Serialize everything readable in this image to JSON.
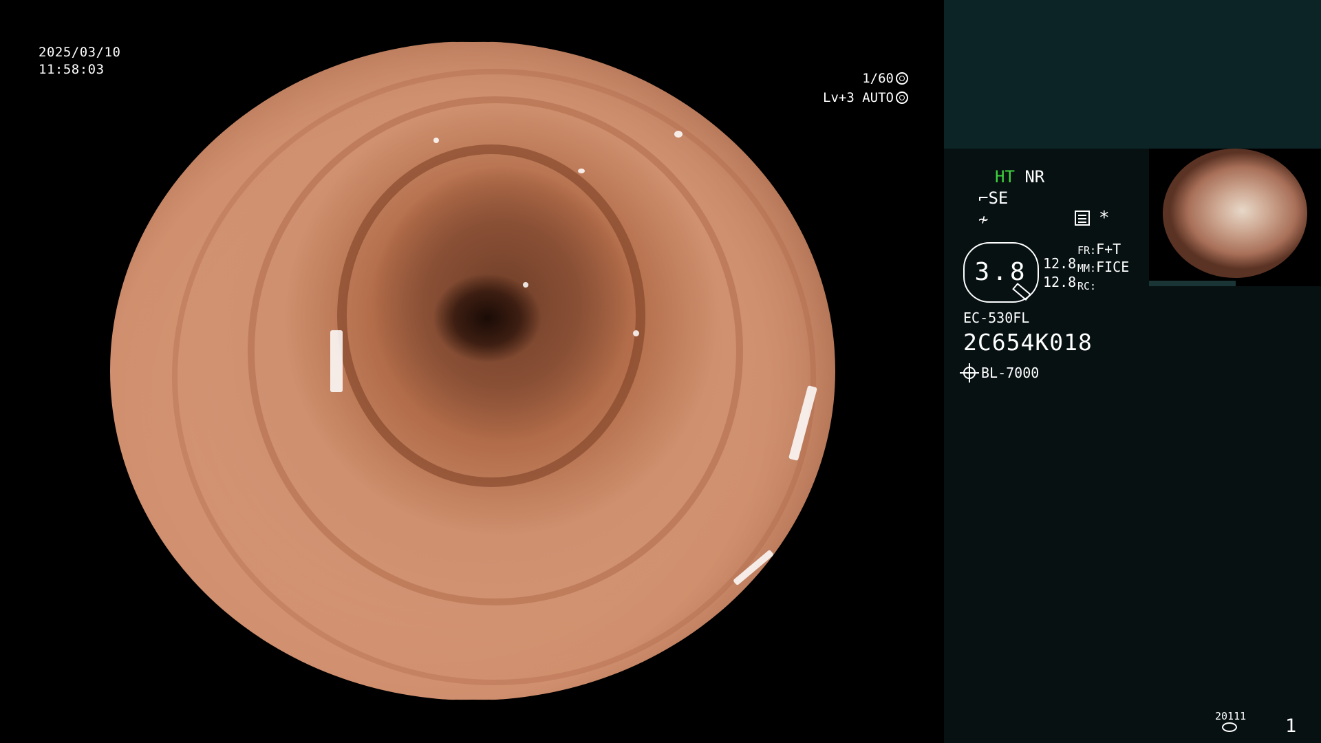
{
  "overlay": {
    "date": "2025/03/10",
    "time": "11:58:03",
    "shutter": "1/60",
    "iris": "Lv+3 AUTO"
  },
  "panel": {
    "ht": "HT",
    "nr": "NR",
    "se": "SE",
    "zoom": "3.8",
    "zoom_val_1": "12.8",
    "zoom_val_2": "12.8",
    "params": [
      {
        "key": "FR:",
        "value": "F+T"
      },
      {
        "key": "MM:",
        "value": "FICE"
      },
      {
        "key": "RC:",
        "value": ""
      }
    ],
    "scope_model": "EC-530FL",
    "scope_serial": "2C654K018",
    "light_source": "BL-7000",
    "footer_code": "20111",
    "page_number": "1"
  }
}
